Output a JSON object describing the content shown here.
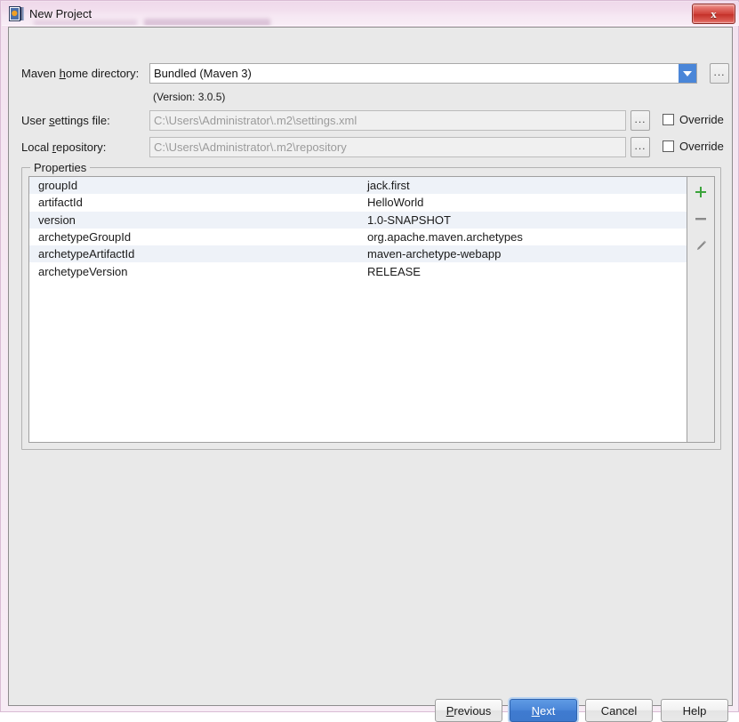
{
  "window": {
    "title": "New Project",
    "app_icon": "intellij-idea-icon",
    "close_label": "x"
  },
  "form": {
    "maven_home": {
      "label_before": "Maven ",
      "label_mnemonic": "h",
      "label_after": "ome directory:",
      "value": "Bundled (Maven 3)",
      "browse_label": "...",
      "dropdown_icon": "chevron-down-icon"
    },
    "version_note": "(Version: 3.0.5)",
    "user_settings": {
      "label_before": "User ",
      "label_mnemonic": "s",
      "label_after": "ettings file:",
      "value": "C:\\Users\\Administrator\\.m2\\settings.xml",
      "browse_label": "...",
      "override_label": "Override",
      "override_checked": false
    },
    "local_repository": {
      "label_before": "Local ",
      "label_mnemonic": "r",
      "label_after": "epository:",
      "value": "C:\\Users\\Administrator\\.m2\\repository",
      "browse_label": "...",
      "override_label": "Override",
      "override_checked": false
    }
  },
  "properties": {
    "legend": "Properties",
    "rows": [
      {
        "key": "groupId",
        "value": "jack.first"
      },
      {
        "key": "artifactId",
        "value": "HelloWorld"
      },
      {
        "key": "version",
        "value": "1.0-SNAPSHOT"
      },
      {
        "key": "archetypeGroupId",
        "value": "org.apache.maven.archetypes"
      },
      {
        "key": "archetypeArtifactId",
        "value": "maven-archetype-webapp"
      },
      {
        "key": "archetypeVersion",
        "value": "RELEASE"
      }
    ],
    "toolbar": {
      "add_icon": "plus-icon",
      "remove_icon": "minus-icon",
      "edit_icon": "pencil-icon"
    }
  },
  "buttons": {
    "previous": {
      "before": "",
      "mnemonic": "P",
      "after": "revious"
    },
    "next": {
      "before": "",
      "mnemonic": "N",
      "after": "ext"
    },
    "cancel": {
      "label": "Cancel"
    },
    "help": {
      "label": "Help"
    }
  },
  "colors": {
    "accent_blue": "#4a86d8",
    "add_green": "#3ba43b",
    "close_red": "#cf3f37",
    "stripe": "#eef2f8",
    "dialog_bg": "#e9e9e9"
  }
}
